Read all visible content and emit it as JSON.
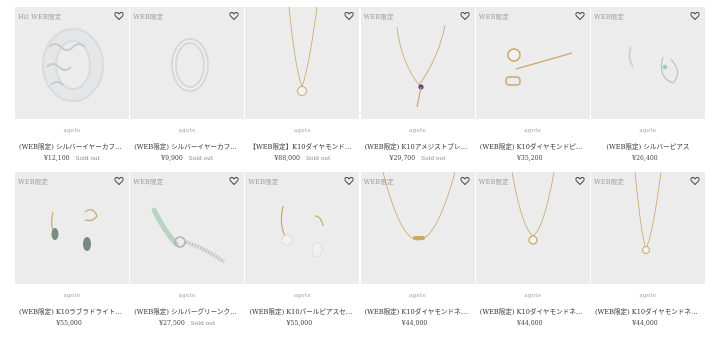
{
  "products": [
    {
      "badge": "Hit  WEB限定",
      "brand": "agete",
      "name": "(WEB限定) シルバーイヤーカフ（…",
      "price": "¥12,100",
      "sold": "Sold out",
      "jewel": "cuff-wide"
    },
    {
      "badge": "WEB限定",
      "brand": "agete",
      "name": "(WEB限定) シルバーイヤーカフ（…",
      "price": "¥9,900",
      "sold": "Sold out",
      "jewel": "cuff-slim"
    },
    {
      "badge": "",
      "brand": "agete",
      "name": "【WEB限定】K10ダイヤモンドネッ…",
      "price": "¥88,000",
      "sold": "Sold out",
      "jewel": "necklace-cluster"
    },
    {
      "badge": "WEB限定",
      "brand": "agete",
      "name": "(WEB限定) K10アメジストブレス…",
      "price": "¥29,700",
      "sold": "Sold out",
      "jewel": "bracelet-amethyst"
    },
    {
      "badge": "WEB限定",
      "brand": "agete",
      "name": "(WEB限定) K10ダイヤモンドピア…",
      "price": "¥35,200",
      "sold": "",
      "jewel": "stud-diamond"
    },
    {
      "badge": "WEB限定",
      "brand": "agete",
      "name": "(WEB限定) シルバーピアス",
      "price": "¥26,400",
      "sold": "",
      "jewel": "hoop-silver"
    },
    {
      "badge": "WEB限定",
      "brand": "agete",
      "name": "(WEB限定) K10ラブラドライトピ…",
      "price": "¥55,000",
      "sold": "",
      "jewel": "drop-labradorite"
    },
    {
      "badge": "WEB限定",
      "brand": "agete",
      "name": "(WEB限定) シルバーグリーンクォ…",
      "price": "¥27,500",
      "sold": "Sold out",
      "jewel": "bracelet-green"
    },
    {
      "badge": "WEB限定",
      "brand": "agete",
      "name": "(WEB限定) K10パールピアスセット",
      "price": "¥55,000",
      "sold": "",
      "jewel": "drop-pearl"
    },
    {
      "badge": "WEB限定",
      "brand": "agete",
      "name": "(WEB限定) K10ダイヤモンドネッ…",
      "price": "¥44,000",
      "sold": "",
      "jewel": "necklace-bar"
    },
    {
      "badge": "WEB限定",
      "brand": "agete",
      "name": "(WEB限定) K10ダイヤモンドネッ…",
      "price": "¥44,000",
      "sold": "",
      "jewel": "necklace-solitaire"
    },
    {
      "badge": "WEB限定",
      "brand": "agete",
      "name": "(WEB限定) K10ダイヤモンドネッ…",
      "price": "¥44,000",
      "sold": "",
      "jewel": "necklace-long"
    }
  ],
  "colors": {
    "photo_bg": "#ececec",
    "gold": "#c9a86a",
    "silver": "#cfd2d4"
  }
}
